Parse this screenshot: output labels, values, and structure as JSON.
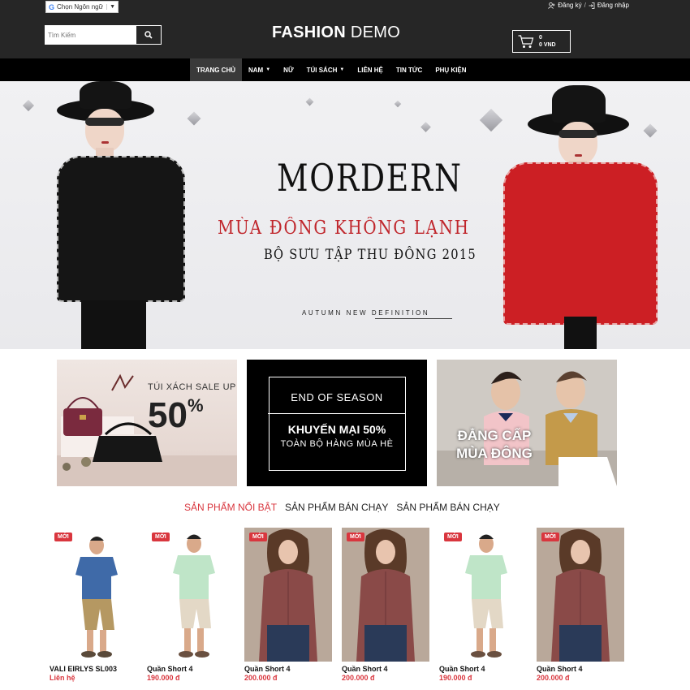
{
  "topbar": {
    "language_label": "Chọn Ngôn ngữ",
    "register": "Đăng ký",
    "separator": "/",
    "login": "Đăng nhập"
  },
  "header": {
    "search_placeholder": "Tìm Kiếm",
    "logo_bold": "FASHION",
    "logo_light": "DEMO",
    "cart_count": "0",
    "cart_total": "0 VND"
  },
  "nav": {
    "items": [
      {
        "label": "TRANG CHỦ"
      },
      {
        "label": "NAM"
      },
      {
        "label": "NỮ"
      },
      {
        "label": "TÚI SÁCH"
      },
      {
        "label": "LIÊN HỆ"
      },
      {
        "label": "TIN TỨC"
      },
      {
        "label": "PHỤ KIỆN"
      }
    ]
  },
  "hero": {
    "title": "MORDERN",
    "subtitle1": "MÙA ĐÔNG KHÔNG LẠNH",
    "subtitle2": "BỘ SƯU TẬP THU ĐÔNG 2015",
    "tagline": "AUTUMN NEW DEFINITION"
  },
  "banners": {
    "b1_text": "TÚI XÁCH SALE UP",
    "b1_percent": "50",
    "b1_percent_sign": "%",
    "b2_line1": "END OF SEASON",
    "b2_line2": "KHUYẾN MẠI 50%",
    "b2_line3": "TOÀN BỘ HÀNG MÙA HÈ",
    "b3_line1": "ĐẲNG CẤP",
    "b3_line2": "MÙA ĐÔNG"
  },
  "tabs": [
    {
      "label": "SẢN PHẨM NỔI BẬT"
    },
    {
      "label": "SẢN PHẨM BÁN CHẠY"
    },
    {
      "label": "SẢN PHẨM BÁN CHẠY"
    }
  ],
  "products": [
    {
      "badge": "MỚI",
      "name": "VALI EIRLYS SL003",
      "price": "Liên hệ"
    },
    {
      "badge": "MỚI",
      "name": "Quần Short 4",
      "price": "190.000 đ"
    },
    {
      "badge": "MỚI",
      "name": "Quần Short 4",
      "price": "200.000 đ"
    },
    {
      "badge": "MỚI",
      "name": "Quần Short 4",
      "price": "200.000 đ"
    },
    {
      "badge": "MỚI",
      "name": "Quần Short 4",
      "price": "190.000 đ"
    },
    {
      "badge": "MỚI",
      "name": "Quần Short 4",
      "price": "200.000 đ"
    }
  ],
  "colors": {
    "header_bg": "#262626",
    "nav_bg": "#000000",
    "accent_red": "#d9363e"
  }
}
